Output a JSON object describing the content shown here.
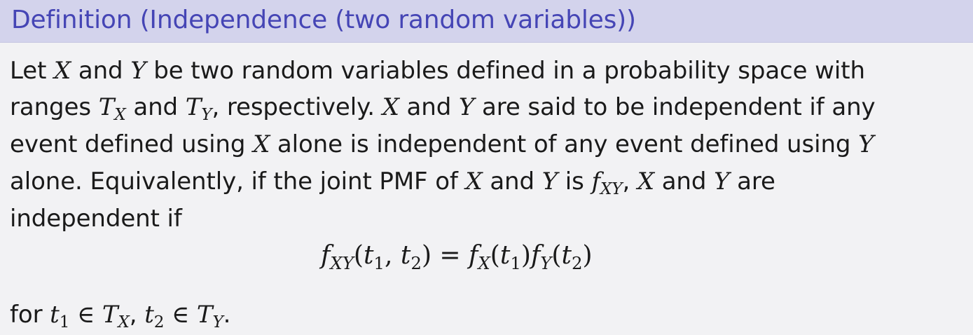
{
  "block": {
    "title": "Definition (Independence (two random variables))"
  },
  "text": {
    "l1_a": "Let ",
    "l1_b": " and ",
    "l1_c": " be two random variables defined in a probability space with",
    "l2_a": "ranges ",
    "l2_b": " and ",
    "l2_c": ", respectively. ",
    "l2_d": " and ",
    "l2_e": " are said to be independent if any",
    "l3_a": "event defined using ",
    "l3_b": " alone is independent of any event defined using ",
    "l4_a": "alone. Equivalently, if the joint PMF of ",
    "l4_b": " and ",
    "l4_c": " is ",
    "l4_d": ", ",
    "l4_e": " and ",
    "l4_f": " are",
    "l5": "independent if",
    "l6_a": "for ",
    "l6_b": ", ",
    "l6_c": "."
  },
  "math": {
    "X": "X",
    "Y": "Y",
    "T": "T",
    "f": "f",
    "t": "t",
    "XY": "XY",
    "one": "1",
    "two": "2",
    "in": " ∈ ",
    "eq": " = ",
    "lparen": "(",
    "rparen": ")",
    "comma": ", "
  }
}
